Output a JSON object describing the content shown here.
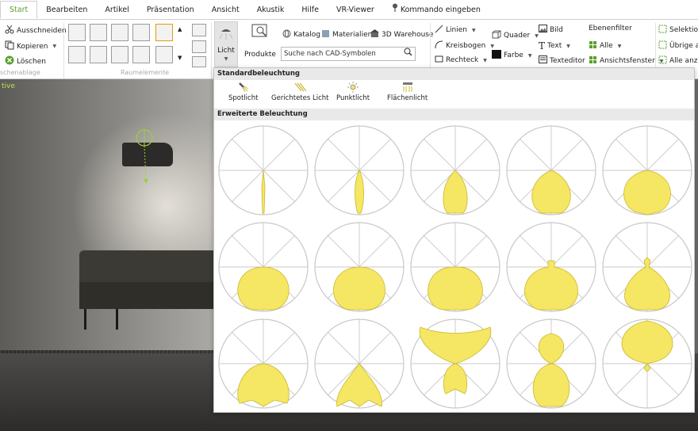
{
  "menu": {
    "tabs": [
      "Start",
      "Bearbeiten",
      "Artikel",
      "Präsentation",
      "Ansicht",
      "Akustik",
      "Hilfe",
      "VR-Viewer"
    ],
    "command": "Kommando eingeben"
  },
  "clipboard": {
    "cut": "Ausschneiden",
    "copy": "Kopieren",
    "delete": "Löschen",
    "group_label": "schenablage"
  },
  "room": {
    "group_label": "Raumelemente"
  },
  "light_button": "Licht",
  "products": "Produkte",
  "catalog": {
    "katalog": "Katalog",
    "materialien": "Materialien",
    "warehouse": "3D Warehouse",
    "search_value": "Suche nach CAD-Symbolen"
  },
  "draw": {
    "linien": "Linien",
    "kreisbogen": "Kreisbogen",
    "rechteck": "Rechteck",
    "quader": "Quader",
    "farbe": "Farbe"
  },
  "insert": {
    "bild": "Bild",
    "text": "Text",
    "texteditor": "Texteditor"
  },
  "layers": {
    "ebenenfilter": "Ebenenfilter",
    "alle": "Alle",
    "ansichtsfenster": "Ansichtsfenster"
  },
  "selection": {
    "selektion": "Selektion",
    "uebrige": "Übrige au",
    "alle_anzeigen": "Alle anzei"
  },
  "viewport": {
    "tag": "tive"
  },
  "panel": {
    "standard_title": "Standardbeleuchtung",
    "standard_items": [
      "Spotlicht",
      "Gerichtetes Licht",
      "Punktlicht",
      "Flächenlicht"
    ],
    "extended_title": "Erweiterte Beleuchtung",
    "diagram_count": 15
  },
  "colors": {
    "accent": "#5aa02c",
    "light_shape": "#f5e663",
    "shape_stroke": "#c9b830",
    "circle": "#c8c8c8"
  }
}
